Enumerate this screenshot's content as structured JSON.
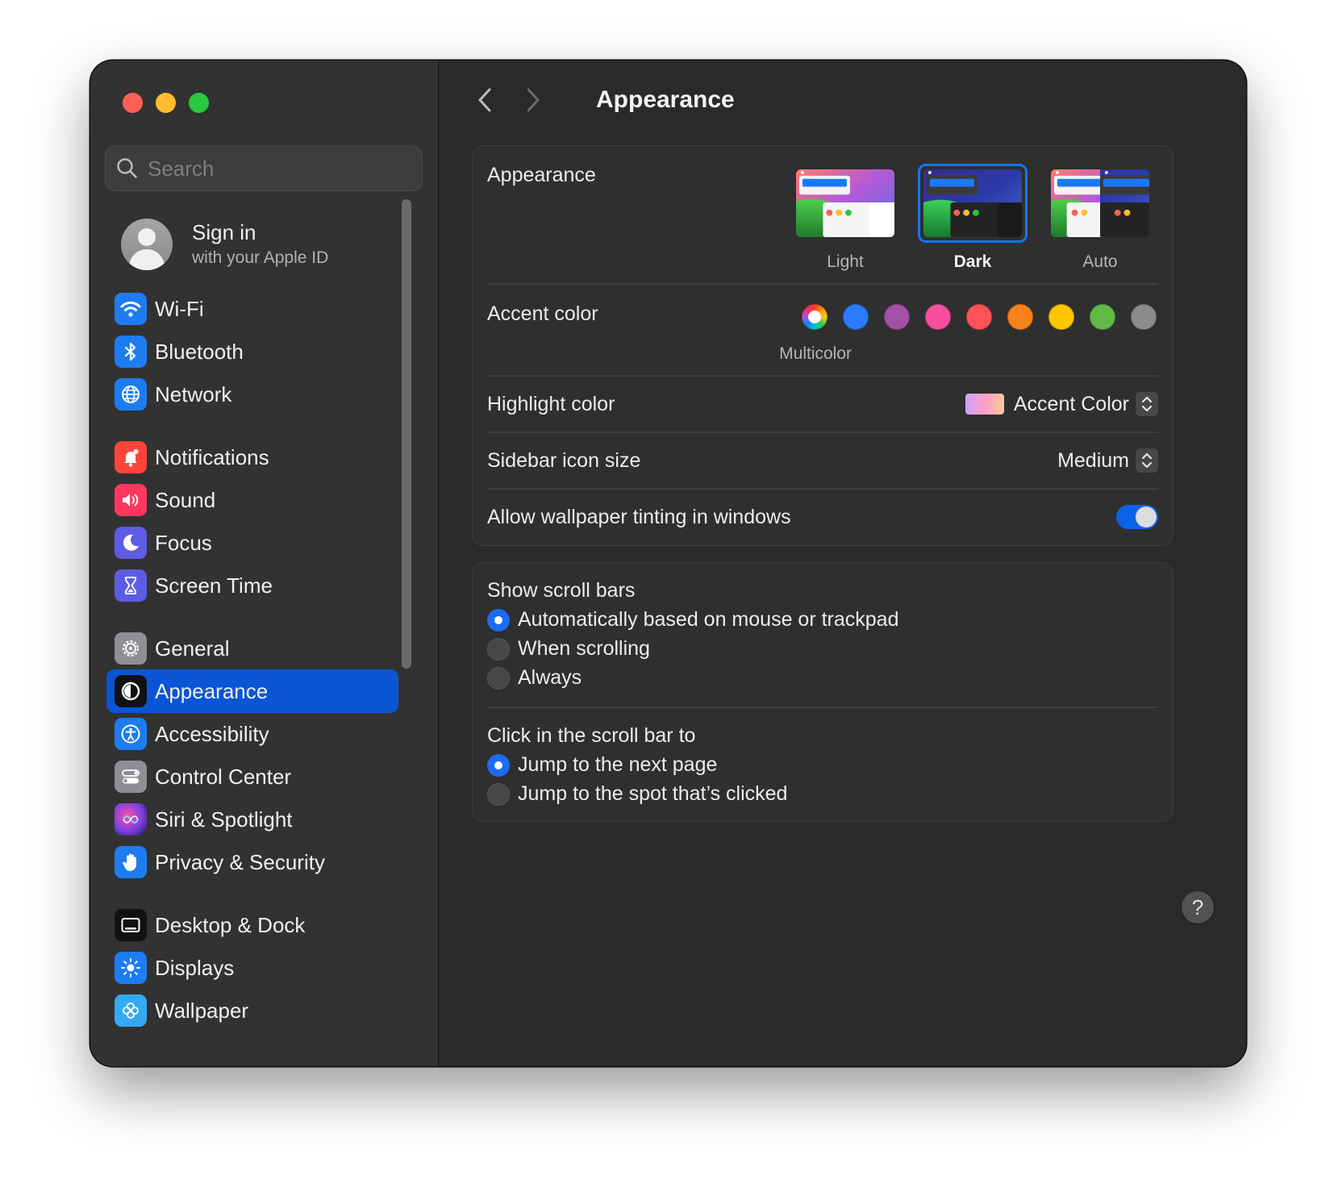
{
  "sidebar": {
    "search": {
      "placeholder": "Search"
    },
    "account": {
      "title": "Sign in",
      "subtitle": "with your Apple ID"
    },
    "items": [
      {
        "label": "Wi-Fi",
        "icon": "wifi-icon",
        "color": "#1d7cf2"
      },
      {
        "label": "Bluetooth",
        "icon": "bluetooth-icon",
        "color": "#1d7cf2"
      },
      {
        "label": "Network",
        "icon": "globe-icon",
        "color": "#1d7cf2"
      },
      {
        "label": "Notifications",
        "icon": "bell-icon",
        "color": "#ff3b30"
      },
      {
        "label": "Sound",
        "icon": "speaker-icon",
        "color": "#ff2d55"
      },
      {
        "label": "Focus",
        "icon": "moon-icon",
        "color": "#5e5ce6"
      },
      {
        "label": "Screen Time",
        "icon": "hourglass-icon",
        "color": "#5e5ce6"
      },
      {
        "label": "General",
        "icon": "gear-icon",
        "color": "#8e8e93"
      },
      {
        "label": "Appearance",
        "icon": "appearance-icon",
        "color": "#111111",
        "selected": true
      },
      {
        "label": "Accessibility",
        "icon": "accessibility-icon",
        "color": "#1d7cf2"
      },
      {
        "label": "Control Center",
        "icon": "control-center-icon",
        "color": "#8e8e93"
      },
      {
        "label": "Siri & Spotlight",
        "icon": "siri-icon",
        "color": "#7b3fe4"
      },
      {
        "label": "Privacy & Security",
        "icon": "hand-icon",
        "color": "#1d7cf2"
      },
      {
        "label": "Desktop & Dock",
        "icon": "dock-icon",
        "color": "#111111"
      },
      {
        "label": "Displays",
        "icon": "sun-icon",
        "color": "#1d7cf2"
      },
      {
        "label": "Wallpaper",
        "icon": "flower-icon",
        "color": "#35aaf0"
      }
    ]
  },
  "toolbar": {
    "title": "Appearance"
  },
  "appearance": {
    "label": "Appearance",
    "options": [
      {
        "label": "Light"
      },
      {
        "label": "Dark",
        "selected": true
      },
      {
        "label": "Auto"
      }
    ]
  },
  "accent": {
    "label": "Accent color",
    "selected_caption": "Multicolor",
    "colors": [
      "#2a7bff",
      "#a550a7",
      "#f74f9e",
      "#ff5257",
      "#f7821b",
      "#ffc600",
      "#62ba46",
      "#8c8c8c"
    ]
  },
  "highlight": {
    "label": "Highlight color",
    "value": "Accent Color"
  },
  "sidebar_icon_size": {
    "label": "Sidebar icon size",
    "value": "Medium"
  },
  "tinting": {
    "label": "Allow wallpaper tinting in windows",
    "enabled": true
  },
  "scroll_bars": {
    "title": "Show scroll bars",
    "options": [
      {
        "label": "Automatically based on mouse or trackpad",
        "selected": true
      },
      {
        "label": "When scrolling",
        "selected": false
      },
      {
        "label": "Always",
        "selected": false
      }
    ]
  },
  "scroll_click": {
    "title": "Click in the scroll bar to",
    "options": [
      {
        "label": "Jump to the next page",
        "selected": true
      },
      {
        "label": "Jump to the spot that’s clicked",
        "selected": false
      }
    ]
  },
  "help": {
    "label": "?"
  }
}
